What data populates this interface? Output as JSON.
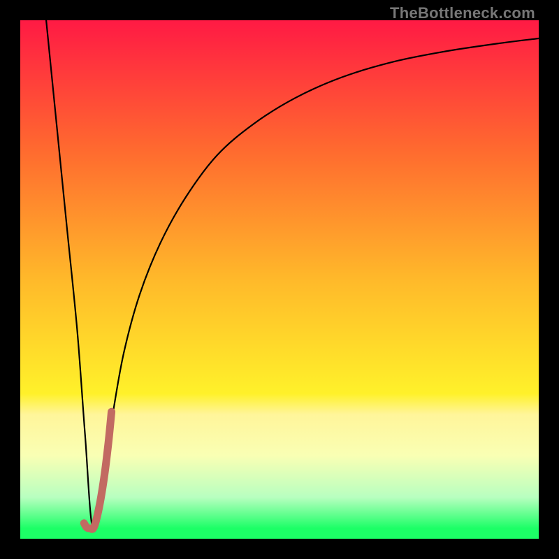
{
  "watermark": "TheBottleneck.com",
  "gradient": {
    "top": "#ff1a44",
    "upper": "#ff6a2f",
    "mid": "#ffb92a",
    "lower": "#fff12a",
    "band_pale": "#fff59a",
    "band_cream": "#f9ffb4",
    "band_mint": "#b8ffc0",
    "band_green": "#1cff66"
  },
  "chart_data": {
    "type": "line",
    "title": "",
    "xlabel": "",
    "ylabel": "",
    "xlim": [
      0,
      100
    ],
    "ylim": [
      0,
      100
    ],
    "grid": false,
    "series": [
      {
        "name": "bottleneck-curve",
        "x": [
          5,
          7,
          9,
          11,
          12.5,
          14,
          16,
          18,
          20,
          23,
          27,
          32,
          38,
          45,
          53,
          62,
          72,
          82,
          92,
          100
        ],
        "y": [
          100,
          80,
          60,
          40,
          20,
          2,
          12,
          25,
          36,
          47,
          57,
          66,
          74,
          80,
          85,
          89,
          92,
          94,
          95.5,
          96.5
        ],
        "color": "#000000",
        "width": 2.2
      },
      {
        "name": "highlight-segment",
        "x": [
          12.3,
          12.8,
          13.4,
          14.2,
          15.2,
          16.2,
          17.0,
          17.6
        ],
        "y": [
          3.0,
          2.2,
          2.0,
          2.2,
          6.0,
          12.0,
          18.5,
          24.5
        ],
        "color": "#c26a62",
        "width": 11
      }
    ]
  }
}
